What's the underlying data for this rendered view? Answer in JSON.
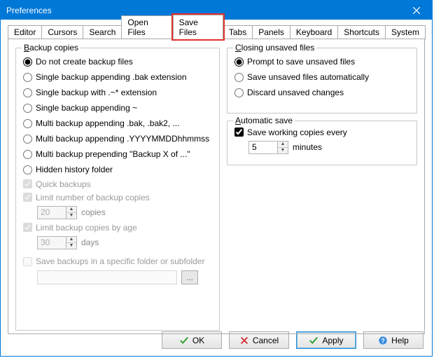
{
  "window": {
    "title": "Preferences"
  },
  "tabs": {
    "editor": "Editor",
    "cursors": "Cursors",
    "search": "Search",
    "open_files": "Open Files",
    "save_files": "Save Files",
    "tabs": "Tabs",
    "panels": "Panels",
    "keyboard": "Keyboard",
    "shortcuts": "Shortcuts",
    "system": "System"
  },
  "backup": {
    "legend": "Backup copies",
    "opt_none": "Do not create backup files",
    "opt_bak": "Single backup appending .bak extension",
    "opt_tilde_star": "Single backup with .~* extension",
    "opt_tilde": "Single backup appending ~",
    "opt_multi_bak": "Multi backup appending .bak, .bak2, ...",
    "opt_multi_date": "Multi backup appending .YYYYMMDDhhmmss",
    "opt_prepend": "Multi backup prepending \"Backup X of ...\"",
    "opt_hidden": "Hidden history folder",
    "chk_quick": "Quick backups",
    "chk_limit_num": "Limit number of backup copies",
    "limit_num_value": "20",
    "limit_num_suffix": "copies",
    "chk_limit_age": "Limit backup copies by age",
    "limit_age_value": "30",
    "limit_age_suffix": "days",
    "chk_folder": "Save backups in a specific folder or subfolder",
    "folder_value": "",
    "browse_label": "..."
  },
  "closing": {
    "legend": "Closing unsaved files",
    "opt_prompt": "Prompt to save unsaved files",
    "opt_auto": "Save unsaved files automatically",
    "opt_discard": "Discard unsaved changes"
  },
  "autosave": {
    "legend": "Automatic save",
    "chk_working": "Save working copies every",
    "value": "5",
    "suffix": "minutes"
  },
  "buttons": {
    "ok": "OK",
    "cancel": "Cancel",
    "apply": "Apply",
    "help": "Help"
  }
}
